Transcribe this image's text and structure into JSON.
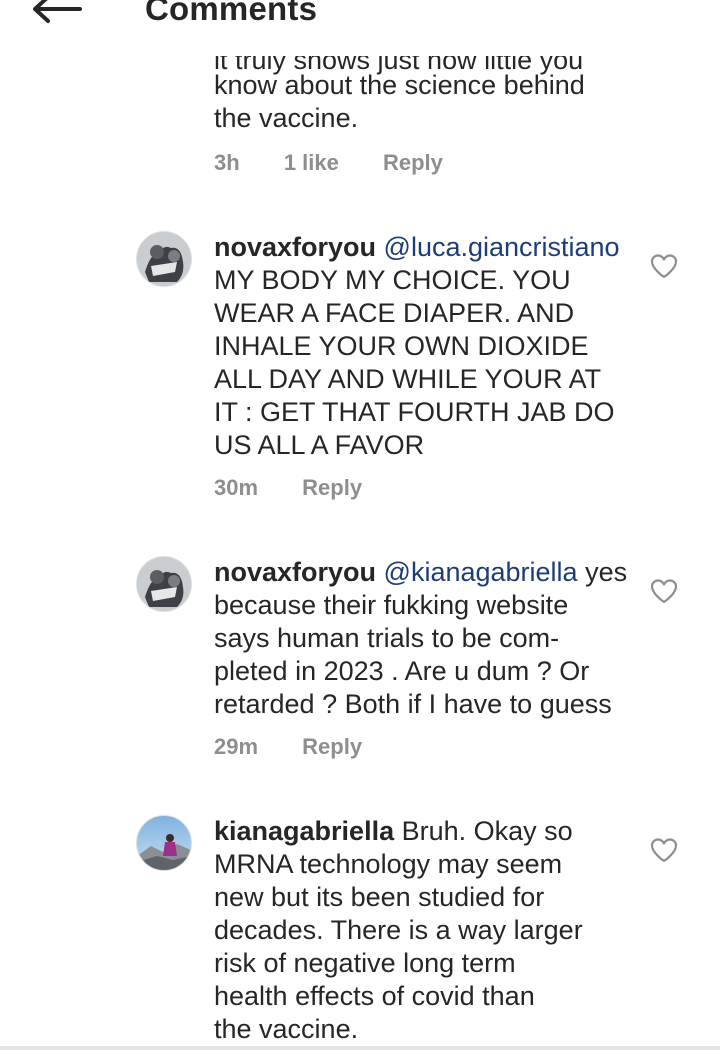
{
  "header": {
    "title": "Comments",
    "back_icon": "arrow-left-icon"
  },
  "partial_comment": {
    "line_partial": "it truly shows just how little you",
    "line1": "know about the science behind",
    "line2": "the vaccine.",
    "time": "3h",
    "likes": "1 like",
    "reply": "Reply"
  },
  "comments": [
    {
      "username": "novaxforyou",
      "mention": "@luca.giancristiano",
      "lines": [
        "MY BODY MY CHOICE. YOU",
        "WEAR A FACE DIAPER. AND",
        "INHALE YOUR OWN DIOXIDE",
        "ALL DAY AND WHILE YOUR AT",
        "IT : GET THAT FOURTH JAB DO",
        "US ALL A FAVOR"
      ],
      "time": "30m",
      "reply": "Reply",
      "avatar_icon": "avatar-icon",
      "like_icon": "heart-outline-icon"
    },
    {
      "username": "novaxforyou",
      "mention": "@kianagabriella",
      "after_mention": " yes",
      "lines": [
        "because their fukking website",
        "says human trials to be com-",
        "pleted in 2023 . Are u dum ? Or",
        "retarded ? Both if I have to guess"
      ],
      "time": "29m",
      "reply": "Reply",
      "avatar_icon": "avatar-icon",
      "like_icon": "heart-outline-icon"
    },
    {
      "username": "kianagabriella",
      "first_line_rest": " Bruh. Okay so",
      "lines": [
        "MRNA technology may seem",
        "new but its been studied for",
        "decades. There is a way larger",
        "risk of negative long term",
        "health effects of covid than",
        "the vaccine."
      ],
      "avatar_icon": "avatar-icon",
      "like_icon": "heart-outline-icon"
    }
  ],
  "colors": {
    "text": "#262626",
    "meta": "#8e8e8e",
    "mention": "#1c3d7a",
    "background": "#ffffff"
  }
}
